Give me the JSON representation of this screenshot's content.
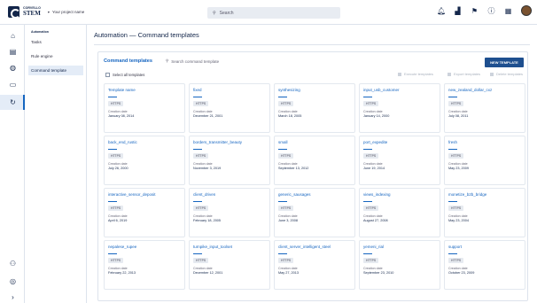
{
  "brand": {
    "line1": "CORVELLO",
    "line2": "STEM"
  },
  "project": {
    "label": "Your project name"
  },
  "search": {
    "placeholder": "Search"
  },
  "topbar": {
    "icons": [
      "bell-icon",
      "chart-icon",
      "flag-icon",
      "help-icon",
      "grid-icon"
    ]
  },
  "rail": {
    "icons": [
      "home-icon",
      "apps-icon",
      "globe-icon",
      "monitor-icon",
      "automation-icon",
      "users-icon",
      "target-icon",
      "expand-icon"
    ]
  },
  "subnav": {
    "heading": "Automation",
    "items": [
      "Tasks",
      "Rule engine",
      "Command template"
    ],
    "selected": "Command template"
  },
  "page": {
    "title": "Automation — Command templates"
  },
  "panel": {
    "title": "Command templates",
    "search_placeholder": "Search command template",
    "new_button": "NEW TEMPLATE",
    "select_all": "Select all templates",
    "actions": [
      "Execute templates",
      "Export templates",
      "Delete templates"
    ]
  },
  "cards": [
    {
      "name": "Template name",
      "badge": "HTTPS",
      "label": "Creation date",
      "date": "January 08, 2014"
    },
    {
      "name": "fixed",
      "badge": "HTTPS",
      "label": "Creation date",
      "date": "December 21, 2001"
    },
    {
      "name": "synthesizing",
      "badge": "HTTPS",
      "label": "Creation date",
      "date": "March 18, 2005"
    },
    {
      "name": "input_usb_customer",
      "badge": "HTTPS",
      "label": "Creation date",
      "date": "January 14, 2000"
    },
    {
      "name": "new_zealand_dollar_cxz",
      "badge": "HTTPS",
      "label": "Creation date",
      "date": "July 08, 2011"
    },
    {
      "name": "back_end_rustic",
      "badge": "HTTPS",
      "label": "Creation date",
      "date": "July 26, 2000"
    },
    {
      "name": "borders_transmitter_beauty",
      "badge": "HTTPS",
      "label": "Creation date",
      "date": "November 3, 2019"
    },
    {
      "name": "small",
      "badge": "HTTPS",
      "label": "Creation date",
      "date": "September 13, 2012"
    },
    {
      "name": "port_expedite",
      "badge": "HTTPS",
      "label": "Creation date",
      "date": "June 19, 2014"
    },
    {
      "name": "fresh",
      "badge": "HTTPS",
      "label": "Creation date",
      "date": "May 23, 2009"
    },
    {
      "name": "interactive_sensor_deposit",
      "badge": "HTTPS",
      "label": "Creation date",
      "date": "April 6, 2019"
    },
    {
      "name": "client_driven",
      "badge": "HTTPS",
      "label": "Creation date",
      "date": "February 18, 2005"
    },
    {
      "name": "generic_sausages",
      "badge": "HTTPS",
      "label": "Creation date",
      "date": "June 3, 2008"
    },
    {
      "name": "views_indexing",
      "badge": "HTTPS",
      "label": "Creation date",
      "date": "August 27, 2008"
    },
    {
      "name": "monetize_b2b_bridge",
      "badge": "HTTPS",
      "label": "Creation date",
      "date": "May 23, 2004"
    },
    {
      "name": "nepalese_rupee",
      "badge": "HTTPS",
      "label": "Creation date",
      "date": "February 22, 2013"
    },
    {
      "name": "turnpike_input_toolset",
      "badge": "HTTPS",
      "label": "Creation date",
      "date": "December 12, 2001"
    },
    {
      "name": "client_server_intelligent_steel",
      "badge": "HTTPS",
      "label": "Creation date",
      "date": "May 27, 2013"
    },
    {
      "name": "yemeni_rial",
      "badge": "HTTPS",
      "label": "Creation date",
      "date": "September 23, 2010"
    },
    {
      "name": "support",
      "badge": "HTTPS",
      "label": "Creation date",
      "date": "October 23, 2009"
    }
  ]
}
